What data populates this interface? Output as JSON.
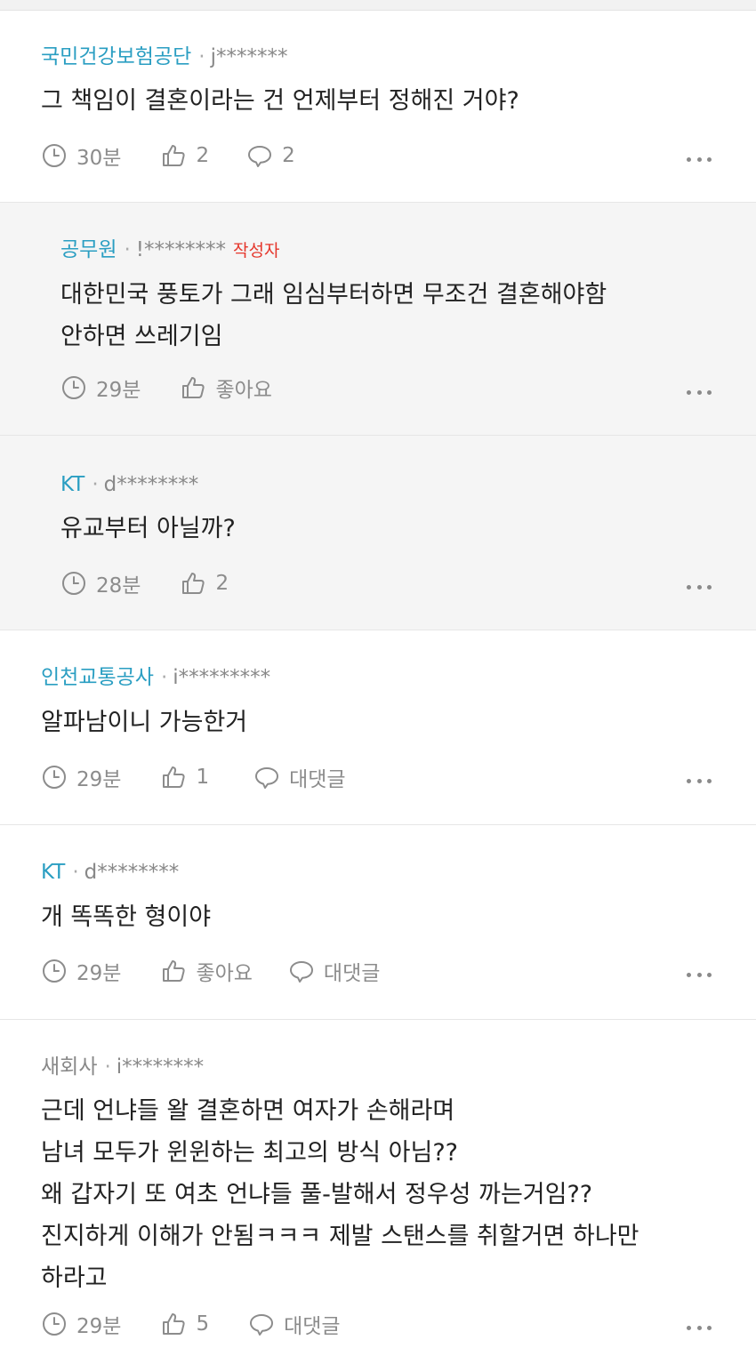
{
  "comments": [
    {
      "nickname": "국민건강보험공단",
      "user_id": "j*******",
      "lines": [
        "그 책임이 결혼이라는 건 언제부터 정해진 거야?"
      ],
      "time": "30분",
      "likes": "2",
      "replies": "2"
    },
    {
      "nickname": "공무원",
      "user_id": "!********",
      "author_tag": "작성자",
      "lines": [
        "대한민국 풍토가 그래 임심부터하면 무조건 결혼해야함",
        "안하면 쓰레기임"
      ],
      "time": "29분",
      "likes": "좋아요"
    },
    {
      "nickname": "KT",
      "user_id": "d********",
      "lines": [
        "유교부터 아닐까?"
      ],
      "time": "28분",
      "likes": "2"
    },
    {
      "nickname": "인천교통공사",
      "user_id": "i*********",
      "lines": [
        "알파남이니 가능한거"
      ],
      "time": "29분",
      "likes": "1",
      "replies": "대댓글"
    },
    {
      "nickname": "KT",
      "user_id": "d********",
      "lines": [
        "개 똑똑한 형이야"
      ],
      "time": "29분",
      "likes": "좋아요",
      "replies": "대댓글"
    },
    {
      "nickname": "새회사",
      "user_id": "i********",
      "lines": [
        "근데 언냐들 왈 결혼하면 여자가 손해라며",
        "남녀 모두가 윈윈하는 최고의 방식 아님??",
        "왜 갑자기 또 여초 언냐들 풀-발해서 정우성 까는거임??",
        "진지하게 이해가 안됨ㅋㅋㅋ 제발 스탠스를 취할거면 하나만",
        "하라고"
      ],
      "time": "29분",
      "likes": "5",
      "replies": "대댓글"
    }
  ],
  "icons": {
    "time": "clock-icon",
    "like": "thumbs-up-icon",
    "reply": "speech-bubble-icon",
    "more": "more-dots-icon"
  },
  "colors": {
    "nickname": "#2a9ec2",
    "nickname_plain": "#888888",
    "author_tag": "#e5362b",
    "reply_background": "#f5f5f5",
    "meta_text": "#8c8c8c"
  }
}
